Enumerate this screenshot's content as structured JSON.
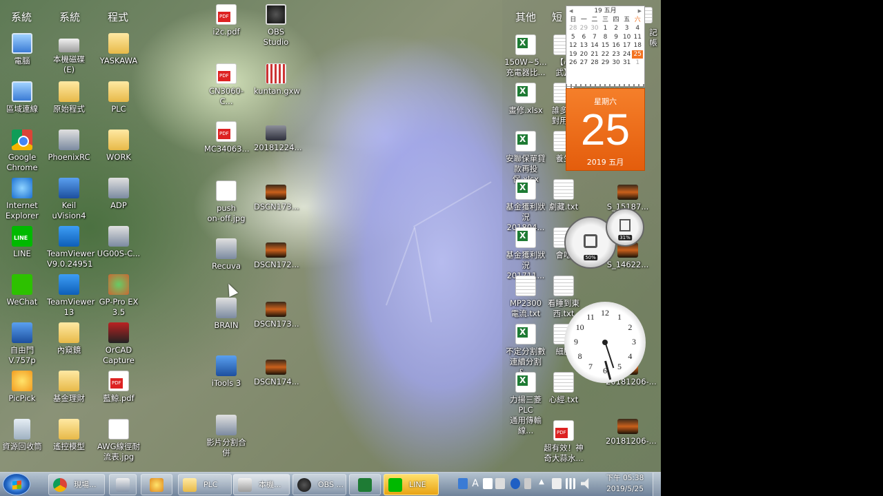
{
  "sidebar": {
    "heading_other": "其他",
    "heading_short": "短",
    "top_right_label": "記帳"
  },
  "column_headers": [
    "系統",
    "系統",
    "程式"
  ],
  "icons": {
    "col1": [
      {
        "label": "電腦",
        "icon": "computer-icon"
      },
      {
        "label": "區域連線",
        "icon": "network-icon"
      },
      {
        "label": "Google\nChrome",
        "icon": "chrome-icon"
      },
      {
        "label": "Internet\nExplorer",
        "icon": "ie-icon"
      },
      {
        "label": "LINE",
        "icon": "line-icon"
      },
      {
        "label": "WeChat",
        "icon": "wechat-icon"
      },
      {
        "label": "自由門\nV.757p",
        "icon": "freegate-icon"
      },
      {
        "label": "PicPick",
        "icon": "picpick-icon"
      },
      {
        "label": "資源回收筒",
        "icon": "recycle-bin-icon"
      }
    ],
    "col2": [
      {
        "label": "本機磁碟 (E)",
        "icon": "drive-icon"
      },
      {
        "label": "原始程式",
        "icon": "folder-icon"
      },
      {
        "label": "PhoenixRC",
        "icon": "phoenixrc-icon"
      },
      {
        "label": "Keil uVision4",
        "icon": "keil-icon"
      },
      {
        "label": "TeamViewer\nV9.0.24951",
        "icon": "teamviewer-icon"
      },
      {
        "label": "TeamViewer\n13",
        "icon": "teamviewer-icon"
      },
      {
        "label": "內窺鏡",
        "icon": "folder-icon"
      },
      {
        "label": "基金理財",
        "icon": "folder-icon"
      },
      {
        "label": "遙控模型",
        "icon": "folder-icon"
      }
    ],
    "col3": [
      {
        "label": "YASKAWA",
        "icon": "folder-icon"
      },
      {
        "label": "PLC",
        "icon": "folder-icon"
      },
      {
        "label": "WORK",
        "icon": "folder-icon"
      },
      {
        "label": "ADP",
        "icon": "adp-icon"
      },
      {
        "label": "UG00S-C...",
        "icon": "film-icon"
      },
      {
        "label": "GP-Pro EX\n3.5",
        "icon": "gp-pro-icon"
      },
      {
        "label": "OrCAD\nCapture",
        "icon": "orcad-icon"
      },
      {
        "label": "藍鯨.pdf",
        "icon": "pdf-icon"
      },
      {
        "label": "AWG線徑耐\n流表.jpg",
        "icon": "image-icon"
      }
    ],
    "col4": [
      {
        "label": "i2c.pdf",
        "icon": "pdf-icon"
      },
      {
        "label": "CN3060-C...",
        "icon": "pdf-icon"
      },
      {
        "label": "MC34063...",
        "icon": "pdf-icon"
      },
      {
        "label": "push\non-off.jpg",
        "icon": "image-icon"
      },
      {
        "label": "Recuva",
        "icon": "recuva-icon"
      },
      {
        "label": "BRAIN",
        "icon": "brain-icon"
      },
      {
        "label": "iTools 3",
        "icon": "itools-icon"
      },
      {
        "label": "影片分割合\n併",
        "icon": "video-split-icon"
      }
    ],
    "col5": [
      {
        "label": "OBS Studio",
        "icon": "obs-icon"
      },
      {
        "label": "kuntan.gxw",
        "icon": "gxw-icon"
      },
      {
        "label": "20181224...",
        "icon": "photo-icon"
      },
      {
        "label": "DSCN173...",
        "icon": "photo-icon"
      },
      {
        "label": "DSCN172...",
        "icon": "photo-icon"
      },
      {
        "label": "DSCN173...",
        "icon": "photo-icon"
      },
      {
        "label": "DSCN174...",
        "icon": "photo-icon"
      }
    ],
    "col6": [
      {
        "label": "150W~5...\n充電器比...",
        "icon": "excel-icon"
      },
      {
        "label": "畫修.xlsx",
        "icon": "excel-icon"
      },
      {
        "label": "安聯保單貸\n款再投保.xlsx",
        "icon": "excel-icon"
      },
      {
        "label": "基金獲利狀\n況201804...",
        "icon": "excel-icon"
      },
      {
        "label": "基金獲利狀\n況201711...",
        "icon": "excel-icon"
      },
      {
        "label": "MP2300\n電流.txt",
        "icon": "text-icon"
      },
      {
        "label": "不定分割數\n連續分割&...",
        "icon": "excel-icon"
      },
      {
        "label": "力揚三菱PLC\n通用傳輸線...",
        "icon": "excel-icon"
      }
    ],
    "col7": [
      {
        "label": "【心\n武】",
        "icon": "text-icon"
      },
      {
        "label": "誰多幾\n對用物",
        "icon": "text-icon"
      },
      {
        "label": "養生",
        "icon": "text-icon"
      },
      {
        "label": "劇藏.txt",
        "icon": "text-icon"
      },
      {
        "label": "會吃",
        "icon": "text-icon"
      },
      {
        "label": "看睡到東西.txt",
        "icon": "text-icon"
      },
      {
        "label": "細胞",
        "icon": "text-icon"
      },
      {
        "label": "心經.txt",
        "icon": "text-icon"
      },
      {
        "label": "超有效！神\n奇大蒜水...",
        "icon": "pdf-icon"
      }
    ],
    "col8": [
      {
        "label": "S_15187...",
        "icon": "photo-icon"
      },
      {
        "label": "S_14622...",
        "icon": "photo-icon"
      },
      {
        "label": "20181206-...",
        "icon": "photo-icon"
      },
      {
        "label": "20181206-...",
        "icon": "photo-icon"
      }
    ]
  },
  "calendar": {
    "month_title": "19 五月",
    "weekdays": [
      "日",
      "一",
      "二",
      "三",
      "四",
      "五",
      "六"
    ],
    "days": [
      "28",
      "29",
      "30",
      "1",
      "2",
      "3",
      "4",
      "5",
      "6",
      "7",
      "8",
      "9",
      "10",
      "11",
      "12",
      "13",
      "14",
      "15",
      "16",
      "17",
      "18",
      "19",
      "20",
      "21",
      "22",
      "23",
      "24",
      "25",
      "26",
      "27",
      "28",
      "29",
      "30",
      "31",
      "1"
    ],
    "today": "25",
    "weekday_label": "星期六",
    "big_day": "25",
    "year_month": "2019 五月"
  },
  "meter": {
    "cpu": "50%",
    "memory": "31%"
  },
  "clock_numbers": [
    "12",
    "1",
    "2",
    "3",
    "4",
    "5",
    "6",
    "7",
    "8",
    "9",
    "10",
    "11"
  ],
  "taskbar": {
    "items": [
      {
        "label": "現場...",
        "icon": "chrome-icon"
      },
      {
        "label": "",
        "icon": "calculator-icon"
      },
      {
        "label": "",
        "icon": "paint-icon"
      },
      {
        "label": "PLC",
        "icon": "folder-icon"
      },
      {
        "label": "本機...",
        "icon": "drive-icon"
      },
      {
        "label": "OBS ...",
        "icon": "obs-icon"
      },
      {
        "label": "",
        "icon": "excel-icon"
      },
      {
        "label": "LINE",
        "icon": "line-icon"
      }
    ],
    "time": "下午 05:38",
    "date": "2019/5/25",
    "ime": "A"
  }
}
